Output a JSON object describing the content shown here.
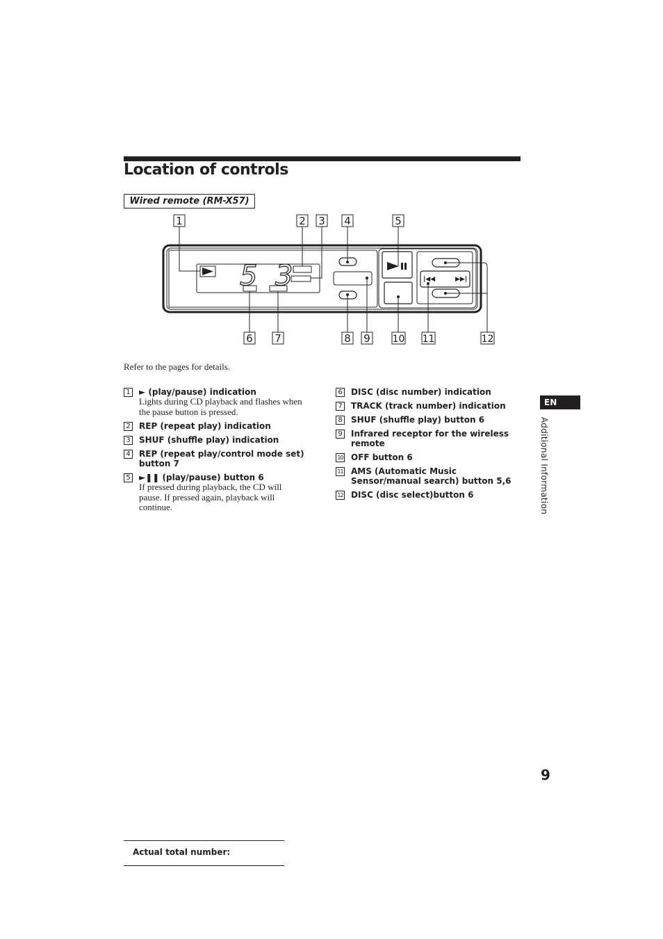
{
  "title": "Location of controls",
  "subtitle": "Wired remote (RM-X57)",
  "diagram": {
    "labels": [
      "1",
      "2",
      "3",
      "4",
      "5",
      "6",
      "7",
      "8",
      "9",
      "10",
      "11",
      "12"
    ],
    "display_digits": [
      "5",
      "3"
    ]
  },
  "refer_text": "Refer to the pages for details.",
  "left_items": [
    {
      "num": "1",
      "head": "(play/pause) indication",
      "desc": "Lights during CD playback and flashes when the pause button is pressed.",
      "icon": "play-icon"
    },
    {
      "num": "2",
      "head": "REP (repeat play) indication"
    },
    {
      "num": "3",
      "head": "SHUF (shuffle play) indication"
    },
    {
      "num": "4",
      "head": "REP (repeat play/control mode set) button 7"
    },
    {
      "num": "5",
      "head": "(play/pause) button 6",
      "desc": "If pressed during playback, the CD will pause. If pressed again, playback will continue.",
      "icon": "play-pause-icon"
    }
  ],
  "right_items": [
    {
      "num": "6",
      "head": "DISC (disc number) indication"
    },
    {
      "num": "7",
      "head": "TRACK (track number) indication"
    },
    {
      "num": "8",
      "head": "SHUF (shuffle play) button 6"
    },
    {
      "num": "9",
      "head": "Infrared receptor for the wireless remote"
    },
    {
      "num": "10",
      "head": "OFF button 6"
    },
    {
      "num": "11",
      "head": "AMS (Automatic Music Sensor/manual search) button 5,6"
    },
    {
      "num": "12",
      "head": "DISC (disc select)button 6"
    }
  ],
  "side_tab": "EN",
  "side_section": "Additional Information",
  "page_number": "9",
  "footer_label": "Actual total number:"
}
